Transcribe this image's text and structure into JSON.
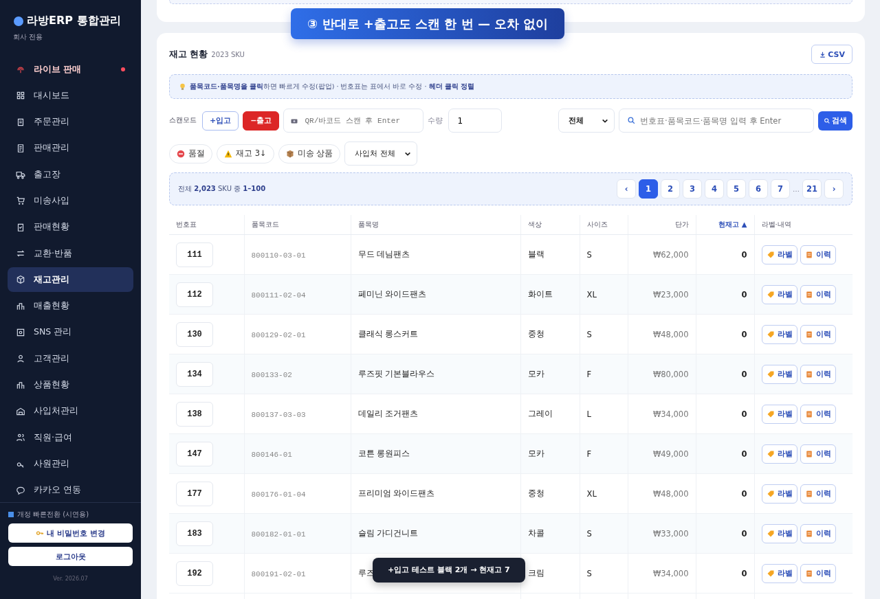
{
  "sidebar": {
    "logo": "라방ERP 통합관리",
    "subtitle": "회사 전용",
    "items": [
      {
        "label": "라이브 판매",
        "selected": false,
        "live": true
      },
      {
        "label": "대시보드",
        "selected": false,
        "live": false
      },
      {
        "label": "주문관리",
        "selected": false,
        "live": false
      },
      {
        "label": "판매관리",
        "selected": false,
        "live": false
      },
      {
        "label": "출고장",
        "selected": false,
        "live": false
      },
      {
        "label": "미송사입",
        "selected": false,
        "live": false
      },
      {
        "label": "판매현황",
        "selected": false,
        "live": false
      },
      {
        "label": "교환·반품",
        "selected": false,
        "live": false
      },
      {
        "label": "재고관리",
        "selected": true,
        "live": false
      },
      {
        "label": "매출현황",
        "selected": false,
        "live": false
      },
      {
        "label": "SNS 관리",
        "selected": false,
        "live": false
      },
      {
        "label": "고객관리",
        "selected": false,
        "live": false
      },
      {
        "label": "상품현황",
        "selected": false,
        "live": false
      },
      {
        "label": "사입처관리",
        "selected": false,
        "live": false
      },
      {
        "label": "직원·급여",
        "selected": false,
        "live": false
      },
      {
        "label": "사원관리",
        "selected": false,
        "live": false
      },
      {
        "label": "카카오 연동",
        "selected": false,
        "live": false
      }
    ],
    "switch_note": "개정 빠른전환 (시연용)",
    "password_button": "내 비밀번호 변경",
    "logout_button": "로그아웃",
    "version": "Ver. 2026.07"
  },
  "banner": "③ 반대로 +출고도 스캔 한 번 — 오차 없이",
  "card": {
    "title": "재고 현황",
    "count": "2023 SKU",
    "csv_button": "CSV",
    "tip": "**품목코드·품목명을 클릭**하면 빠르게 수정(팝업) · 번호표는 표에서 바로 수정 · **헤더 클릭 정렬**",
    "scan_label": "스캔모드",
    "in_button": "+입고",
    "out_button": "−출고",
    "in_selected": false,
    "out_selected": true,
    "scan_placeholder": "QR/바코드 스캔 후 Enter",
    "qty_label": "수량",
    "qty_value": "1",
    "filter_select": "전체",
    "search_placeholder": "번호표·품목코드·품목명 입력 후 Enter",
    "search_button": "검색",
    "chips": [
      {
        "label": "품절",
        "kind": "soldout"
      },
      {
        "label": "재고 3↓",
        "kind": "low"
      },
      {
        "label": "미송 상품",
        "kind": "pending"
      }
    ],
    "supplier_select": "사입처 전체",
    "summary": "전체 **2,023** SKU 중 **1–100**",
    "pages": [
      {
        "label": "‹",
        "kind": "arrow"
      },
      {
        "label": "1",
        "kind": "page",
        "selected": true
      },
      {
        "label": "2",
        "kind": "page",
        "selected": false
      },
      {
        "label": "3",
        "kind": "page",
        "selected": false
      },
      {
        "label": "4",
        "kind": "page",
        "selected": false
      },
      {
        "label": "5",
        "kind": "page",
        "selected": false
      },
      {
        "label": "6",
        "kind": "page",
        "selected": false
      },
      {
        "label": "7",
        "kind": "page",
        "selected": false
      },
      {
        "label": "…",
        "kind": "gap"
      },
      {
        "label": "21",
        "kind": "page",
        "selected": false
      },
      {
        "label": "›",
        "kind": "arrow"
      }
    ],
    "columns": [
      {
        "label": "번호표",
        "sorted": false
      },
      {
        "label": "품목코드",
        "sorted": false
      },
      {
        "label": "품목명",
        "sorted": false
      },
      {
        "label": "색상",
        "sorted": false
      },
      {
        "label": "사이즈",
        "sorted": false
      },
      {
        "label": "단가",
        "sorted": false
      },
      {
        "label": "현재고 ▲",
        "sorted": true
      },
      {
        "label": "라벨·내역",
        "sorted": false
      }
    ],
    "rows": [
      {
        "tag": "111",
        "code": "800110-03-01",
        "name": "무드 데님팬츠",
        "color_name": "블랙",
        "size": "S",
        "price": "₩62,000",
        "stock": "0",
        "label_button": "라벨",
        "history_button": "이력"
      },
      {
        "tag": "112",
        "code": "800111-02-04",
        "name": "페미닌 와이드팬츠",
        "color_name": "화이트",
        "size": "XL",
        "price": "₩23,000",
        "stock": "0",
        "label_button": "라벨",
        "history_button": "이력"
      },
      {
        "tag": "130",
        "code": "800129-02-01",
        "name": "클래식 롱스커트",
        "color_name": "중청",
        "size": "S",
        "price": "₩48,000",
        "stock": "0",
        "label_button": "라벨",
        "history_button": "이력"
      },
      {
        "tag": "134",
        "code": "800133-02",
        "name": "루즈핏 기본블라우스",
        "color_name": "모카",
        "size": "F",
        "price": "₩80,000",
        "stock": "0",
        "label_button": "라벨",
        "history_button": "이력"
      },
      {
        "tag": "138",
        "code": "800137-03-03",
        "name": "데일리 조거팬츠",
        "color_name": "그레이",
        "size": "L",
        "price": "₩34,000",
        "stock": "0",
        "label_button": "라벨",
        "history_button": "이력"
      },
      {
        "tag": "147",
        "code": "800146-01",
        "name": "코튼 롱원피스",
        "color_name": "모카",
        "size": "F",
        "price": "₩49,000",
        "stock": "0",
        "label_button": "라벨",
        "history_button": "이력"
      },
      {
        "tag": "177",
        "code": "800176-01-04",
        "name": "프리미엄 와이드팬츠",
        "color_name": "중청",
        "size": "XL",
        "price": "₩48,000",
        "stock": "0",
        "label_button": "라벨",
        "history_button": "이력"
      },
      {
        "tag": "183",
        "code": "800182-01-01",
        "name": "슬림 가디건니트",
        "color_name": "차콜",
        "size": "S",
        "price": "₩33,000",
        "stock": "0",
        "label_button": "라벨",
        "history_button": "이력"
      },
      {
        "tag": "192",
        "code": "800191-02-01",
        "name": "루즈",
        "color_name": "크림",
        "size": "S",
        "price": "₩34,000",
        "stock": "0",
        "label_button": "라벨",
        "history_button": "이력"
      }
    ]
  },
  "toast": "+입고 테스트 블랙 2개 → 현재고 7"
}
